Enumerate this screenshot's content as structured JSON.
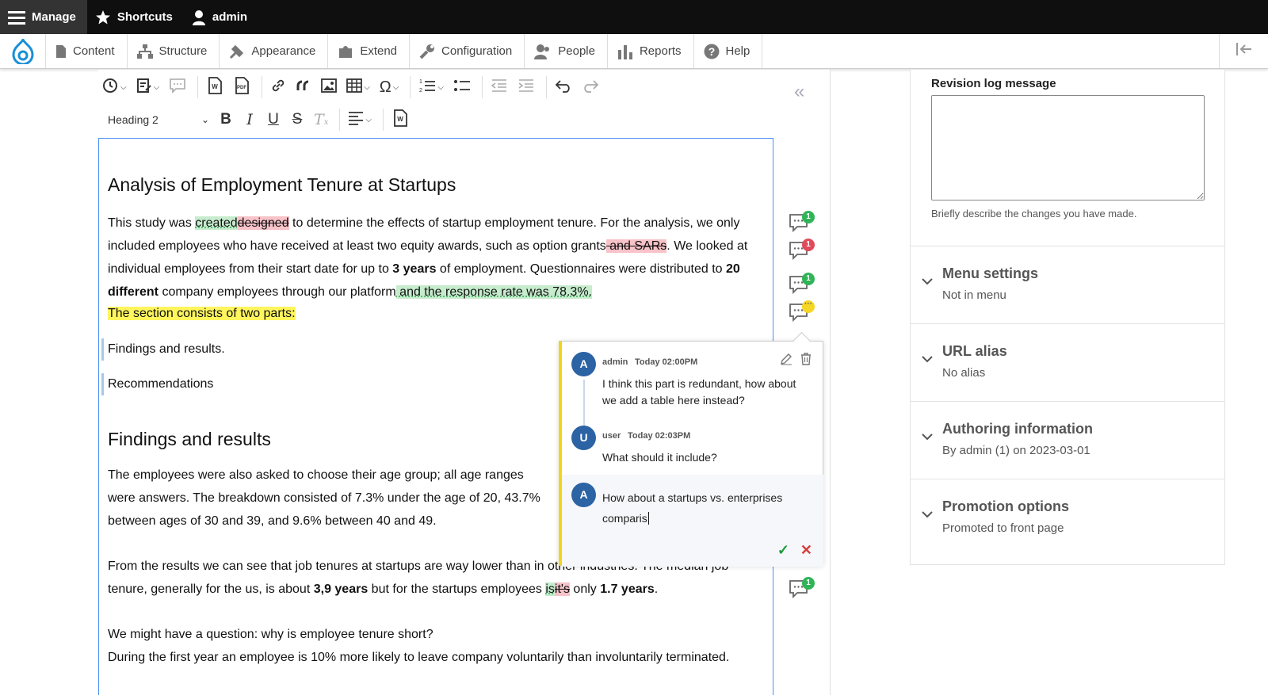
{
  "topbar": {
    "manage": "Manage",
    "shortcuts": "Shortcuts",
    "user": "admin"
  },
  "admin_menu": {
    "items": [
      {
        "label": "Content",
        "icon": "content-icon"
      },
      {
        "label": "Structure",
        "icon": "structure-icon"
      },
      {
        "label": "Appearance",
        "icon": "appearance-icon"
      },
      {
        "label": "Extend",
        "icon": "extend-icon"
      },
      {
        "label": "Configuration",
        "icon": "configuration-icon"
      },
      {
        "label": "People",
        "icon": "people-icon"
      },
      {
        "label": "Reports",
        "icon": "reports-icon"
      },
      {
        "label": "Help",
        "icon": "help-icon"
      }
    ]
  },
  "toolbar": {
    "heading_select": "Heading 2"
  },
  "document": {
    "heading1": "Analysis of Employment Tenure at Startups",
    "p1_a": "This study was ",
    "p1_ins1": "created",
    "p1_del1": "designed",
    "p1_b": " to determine the effects of startup employment tenure. For the analysis, we only included employees who have received at least two equity awards, such as option grants",
    "p1_del2": " and SARs",
    "p1_c": ". We looked at individual employees from their start date for up to ",
    "p1_bold1": "3 years",
    "p1_d": " of employment. Questionnaires were distributed to ",
    "p1_bold2": "20 different",
    "p1_e": " company employees through our platform",
    "p1_ins2": " and the response rate was 78.3%.",
    "p2": "The section consists of two parts:",
    "p3": "Findings and results.",
    "p4": "Recommendations",
    "heading2": "Findings and results",
    "p5": "The employees were also asked to choose their age group; all age ranges were answers. The breakdown consisted of 7.3% under the age of 20, 43.7% between ages of 30 and 39, and 9.6% between 40 and 49.",
    "p6_a": "From the results we can see that job tenures at startups are way lower than in other industries. The median job tenure, generally for the us, is about ",
    "p6_bold1": "3,9 years",
    "p6_b": " but for the startups employees ",
    "p6_ins": "is",
    "p6_del": "it's",
    "p6_c": " only ",
    "p6_bold2": "1.7 years",
    "p6_d": ".",
    "p7_a": "We might have a question: why is employee tenure short?",
    "p7_b": "During the first year an employee is 10% more likely to leave company voluntarily than involuntarily terminated."
  },
  "markers": [
    {
      "badge": "1",
      "color": "#2fb457"
    },
    {
      "badge": "1",
      "color": "#e04a5a"
    },
    {
      "badge": "1",
      "color": "#2fb457"
    },
    {
      "badge": "···",
      "color": "#f5d623"
    },
    {
      "badge": "1",
      "color": "#2fb457"
    }
  ],
  "thread": {
    "comments": [
      {
        "avatar": "A",
        "author": "admin",
        "time": "Today 02:00PM",
        "text": "I think this part is redundant, how about we add a table here instead?"
      },
      {
        "avatar": "U",
        "author": "user",
        "time": "Today 02:03PM",
        "text": "What should it include?"
      }
    ],
    "reply": {
      "avatar": "A",
      "text": "How about a startups vs. enterprises comparis"
    }
  },
  "sidebar": {
    "revision_label": "Revision log message",
    "revision_value": "",
    "revision_help": "Briefly describe the changes you have made.",
    "sections": [
      {
        "title": "Menu settings",
        "summary": "Not in menu"
      },
      {
        "title": "URL alias",
        "summary": "No alias"
      },
      {
        "title": "Authoring information",
        "summary": "By admin (1) on 2023-03-01"
      },
      {
        "title": "Promotion options",
        "summary": "Promoted to front page"
      }
    ]
  }
}
